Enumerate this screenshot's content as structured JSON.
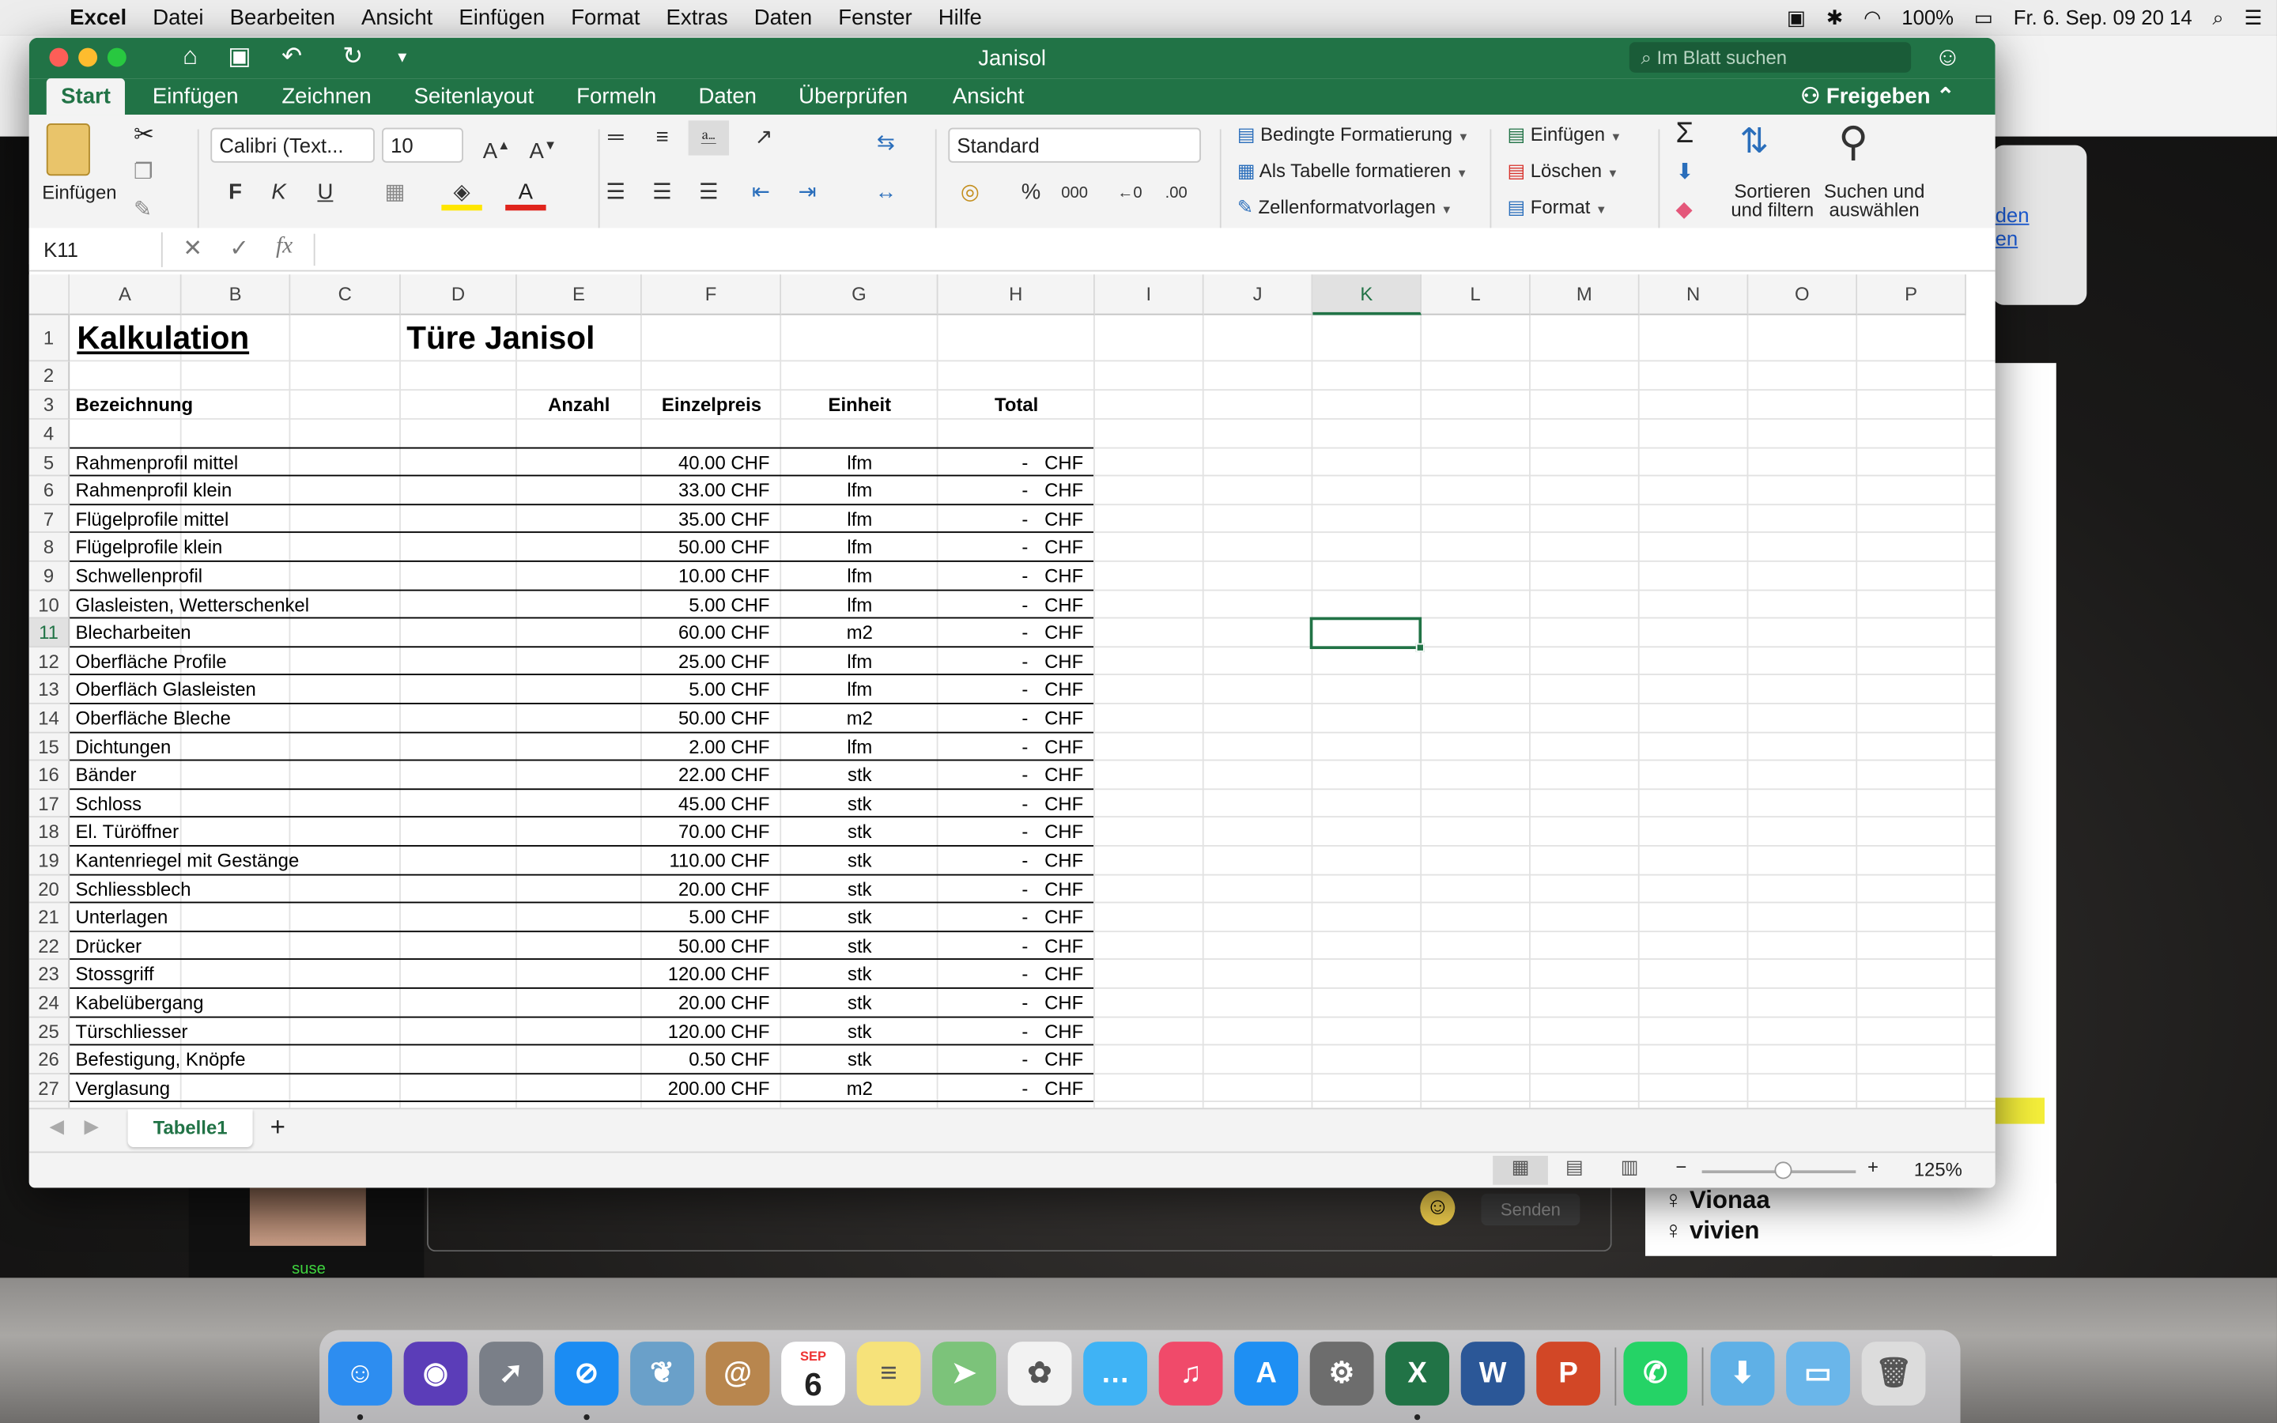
{
  "menubar": {
    "app": "Excel",
    "items": [
      "Datei",
      "Bearbeiten",
      "Ansicht",
      "Einfügen",
      "Format",
      "Extras",
      "Daten",
      "Fenster",
      "Hilfe"
    ],
    "battery": "100%",
    "datetime": "Fr. 6. Sep.  09 20 14"
  },
  "window": {
    "title": "Janisol",
    "search_placeholder": "Im Blatt suchen"
  },
  "tabs": [
    "Start",
    "Einfügen",
    "Zeichnen",
    "Seitenlayout",
    "Formeln",
    "Daten",
    "Überprüfen",
    "Ansicht"
  ],
  "share_label": "Freigeben",
  "ribbon": {
    "paste_label": "Einfügen",
    "font_name": "Calibri (Text...",
    "font_size": "10",
    "bold": "F",
    "italic": "K",
    "underline": "U",
    "number_format": "Standard",
    "percent": "%",
    "thousands": "000",
    "cond_format": "Bedingte Formatierung",
    "as_table": "Als Tabelle formatieren",
    "cell_styles": "Zellenformatvorlagen",
    "insert": "Einfügen",
    "delete": "Löschen",
    "format": "Format",
    "sort_line1": "Sortieren",
    "sort_line2": "und filtern",
    "find_line1": "Suchen und",
    "find_line2": "auswählen"
  },
  "formula_bar": {
    "name_box": "K11",
    "fx": "fx",
    "content": ""
  },
  "columns": [
    "A",
    "B",
    "C",
    "D",
    "E",
    "F",
    "G",
    "H",
    "I",
    "J",
    "K",
    "L",
    "M",
    "N",
    "O",
    "P"
  ],
  "selected_column": "K",
  "selected_row": "11",
  "sheet": {
    "title": "Kalkulation",
    "subtitle": "Türe Janisol",
    "headers": {
      "bezeichnung": "Bezeichnung",
      "anzahl": "Anzahl",
      "einzelpreis": "Einzelpreis",
      "einheit": "Einheit",
      "total": "Total"
    },
    "rows": [
      {
        "row": "5",
        "name": "Rahmenprofil mittel",
        "price": "40.00 CHF",
        "unit": "lfm",
        "total": "-",
        "cur": "CHF"
      },
      {
        "row": "6",
        "name": "Rahmenprofil klein",
        "price": "33.00 CHF",
        "unit": "lfm",
        "total": "-",
        "cur": "CHF"
      },
      {
        "row": "7",
        "name": "Flügelprofile mittel",
        "price": "35.00 CHF",
        "unit": "lfm",
        "total": "-",
        "cur": "CHF"
      },
      {
        "row": "8",
        "name": "Flügelprofile klein",
        "price": "50.00 CHF",
        "unit": "lfm",
        "total": "-",
        "cur": "CHF"
      },
      {
        "row": "9",
        "name": "Schwellenprofil",
        "price": "10.00 CHF",
        "unit": "lfm",
        "total": "-",
        "cur": "CHF"
      },
      {
        "row": "10",
        "name": "Glasleisten, Wetterschenkel",
        "price": "5.00 CHF",
        "unit": "lfm",
        "total": "-",
        "cur": "CHF"
      },
      {
        "row": "11",
        "name": "Blecharbeiten",
        "price": "60.00 CHF",
        "unit": "m2",
        "total": "-",
        "cur": "CHF"
      },
      {
        "row": "12",
        "name": "Oberfläche Profile",
        "price": "25.00 CHF",
        "unit": "lfm",
        "total": "-",
        "cur": "CHF"
      },
      {
        "row": "13",
        "name": "Oberfläch Glasleisten",
        "price": "5.00 CHF",
        "unit": "lfm",
        "total": "-",
        "cur": "CHF"
      },
      {
        "row": "14",
        "name": "Oberfläche Bleche",
        "price": "50.00 CHF",
        "unit": "m2",
        "total": "-",
        "cur": "CHF"
      },
      {
        "row": "15",
        "name": "Dichtungen",
        "price": "2.00 CHF",
        "unit": "lfm",
        "total": "-",
        "cur": "CHF"
      },
      {
        "row": "16",
        "name": "Bänder",
        "price": "22.00 CHF",
        "unit": "stk",
        "total": "-",
        "cur": "CHF"
      },
      {
        "row": "17",
        "name": "Schloss",
        "price": "45.00 CHF",
        "unit": "stk",
        "total": "-",
        "cur": "CHF"
      },
      {
        "row": "18",
        "name": "El. Türöffner",
        "price": "70.00 CHF",
        "unit": "stk",
        "total": "-",
        "cur": "CHF"
      },
      {
        "row": "19",
        "name": "Kantenriegel mit Gestänge",
        "price": "110.00 CHF",
        "unit": "stk",
        "total": "-",
        "cur": "CHF"
      },
      {
        "row": "20",
        "name": "Schliessblech",
        "price": "20.00 CHF",
        "unit": "stk",
        "total": "-",
        "cur": "CHF"
      },
      {
        "row": "21",
        "name": "Unterlagen",
        "price": "5.00 CHF",
        "unit": "stk",
        "total": "-",
        "cur": "CHF"
      },
      {
        "row": "22",
        "name": "Drücker",
        "price": "50.00 CHF",
        "unit": "stk",
        "total": "-",
        "cur": "CHF"
      },
      {
        "row": "23",
        "name": "Stossgriff",
        "price": "120.00 CHF",
        "unit": "stk",
        "total": "-",
        "cur": "CHF"
      },
      {
        "row": "24",
        "name": "Kabelübergang",
        "price": "20.00 CHF",
        "unit": "stk",
        "total": "-",
        "cur": "CHF"
      },
      {
        "row": "25",
        "name": "Türschliesser",
        "price": "120.00 CHF",
        "unit": "stk",
        "total": "-",
        "cur": "CHF"
      },
      {
        "row": "26",
        "name": "Befestigung, Knöpfe",
        "price": "0.50 CHF",
        "unit": "stk",
        "total": "-",
        "cur": "CHF"
      },
      {
        "row": "27",
        "name": "Verglasung",
        "price": "200.00 CHF",
        "unit": "m2",
        "total": "-",
        "cur": "CHF"
      }
    ]
  },
  "sheet_tab": "Tabelle1",
  "zoom": "125%",
  "background": {
    "link1": "den",
    "link2": "en",
    "chat_names": [
      "Vionaa",
      "vivien"
    ],
    "send_label": "Senden",
    "user_label": "suse"
  },
  "dock": {
    "calendar_month": "SEP",
    "calendar_day": "6",
    "excel": "X",
    "word": "W",
    "powerpoint": "P"
  },
  "colors": {
    "excel_green": "#217346",
    "title_bar": "#217346"
  }
}
